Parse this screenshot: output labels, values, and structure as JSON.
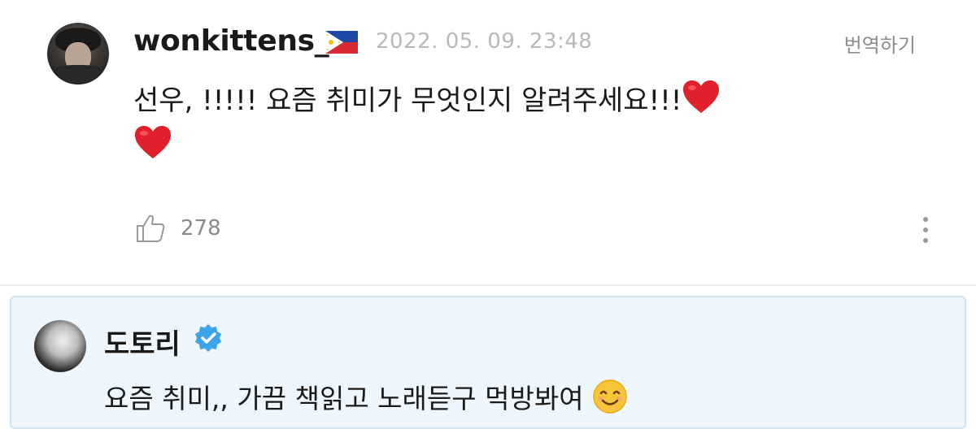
{
  "comment": {
    "username": "wonkittens_",
    "flag_icon": "philippines-flag-icon",
    "timestamp": "2022. 05. 09. 23:48",
    "translate_label": "번역하기",
    "text": "선우, !!!!! 요즘 취미가 무엇인지 알려주세요!!!",
    "emoji": "red-heart-icon",
    "like_count": "278",
    "like_icon": "thumbs-up-icon",
    "more_icon": "more-vertical-icon"
  },
  "reply": {
    "name": "도토리",
    "badge_icon": "verified-badge-icon",
    "text": "요즘 취미,, 가끔 책읽고 노래듣구 먹방봐여",
    "emoji": "smiling-face-icon"
  },
  "colors": {
    "reply_background": "#edf7fd",
    "reply_border": "#cfe3f1",
    "verified": "#3fa3ea",
    "heart": "#e0202a",
    "muted_text": "#8a8a8a"
  }
}
